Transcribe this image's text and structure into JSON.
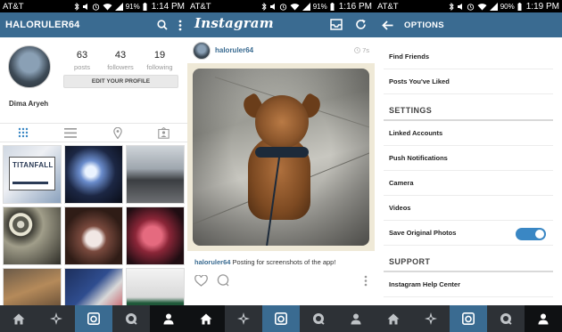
{
  "phones": [
    {
      "status": {
        "carrier": "AT&T",
        "battery": "91%",
        "time": "1:14 PM"
      },
      "header": {
        "title": "HALORULER64"
      },
      "profile": {
        "name": "Dima Aryeh",
        "stats": [
          {
            "value": "63",
            "label": "posts"
          },
          {
            "value": "43",
            "label": "followers"
          },
          {
            "value": "19",
            "label": "following"
          }
        ],
        "edit_button": "EDIT YOUR PROFILE"
      },
      "thumbs": [
        {
          "text": "TITANFALL"
        }
      ]
    },
    {
      "status": {
        "carrier": "AT&T",
        "battery": "91%",
        "time": "1:16 PM"
      },
      "header": {
        "logo": "Instagram"
      },
      "post": {
        "username": "haloruler64",
        "age": "7s",
        "caption_user": "haloruler64",
        "caption_text": "Posting for screenshots of the app!"
      }
    },
    {
      "status": {
        "carrier": "AT&T",
        "battery": "90%",
        "time": "1:19 PM"
      },
      "header": {
        "title": "OPTIONS"
      },
      "items_top": [
        "Find Friends",
        "Posts You've Liked"
      ],
      "settings_heading": "SETTINGS",
      "settings_items": [
        "Linked Accounts",
        "Push Notifications",
        "Camera",
        "Videos",
        "Save Original Photos"
      ],
      "save_original_on": true,
      "support_heading": "SUPPORT",
      "support_items": [
        "Instagram Help Center"
      ]
    }
  ],
  "colors": {
    "bar": "#3a6b91",
    "nav": "#2d3136",
    "toggle": "#3a87c4"
  },
  "nav_icons": [
    "home-icon",
    "explore-icon",
    "camera-icon",
    "news-icon",
    "profile-icon"
  ]
}
